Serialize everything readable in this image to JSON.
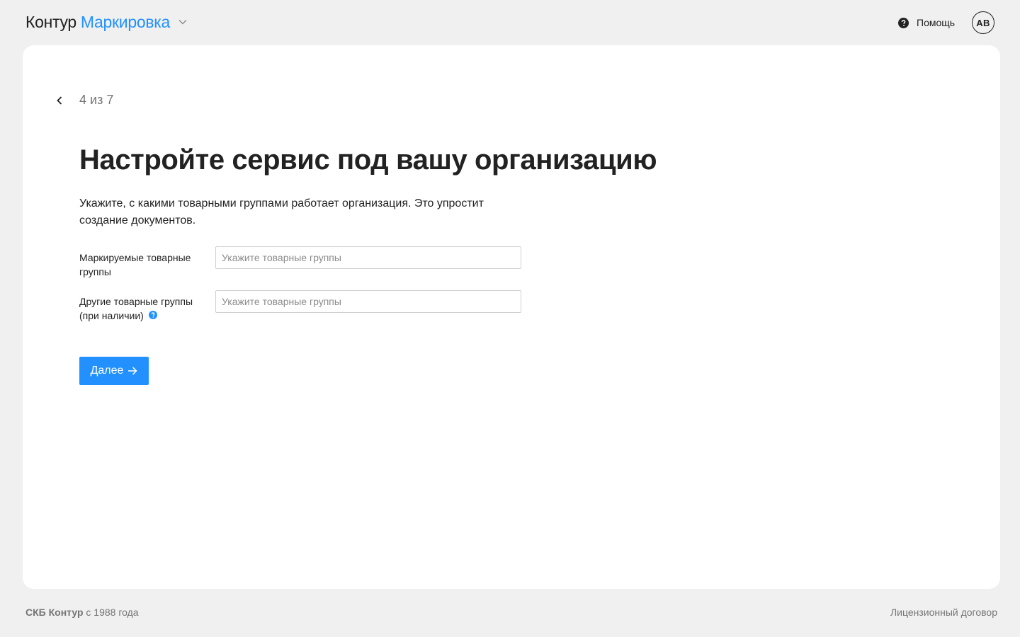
{
  "header": {
    "brand": "Контур",
    "product": "Маркировка",
    "help_label": "Помощь",
    "avatar_initials": "АВ"
  },
  "step": {
    "text": "4 из 7",
    "current": 4,
    "total": 7
  },
  "main": {
    "title": "Настройте сервис под вашу организацию",
    "description": "Укажите, с какими товарными группами работает организация. Это упростит создание документов.",
    "fields": [
      {
        "label": "Маркируемые товарные группы",
        "placeholder": "Укажите товарные группы",
        "value": ""
      },
      {
        "label": "Другие товарные группы (при наличии)",
        "placeholder": "Укажите товарные группы",
        "value": "",
        "has_info_icon": true
      }
    ],
    "next_button_label": "Далее"
  },
  "footer": {
    "company": "СКБ Контур",
    "since": "с 1988 года",
    "license_link": "Лицензионный договор"
  },
  "colors": {
    "accent": "#2291ff",
    "page_background": "#f0f0f0",
    "card_background": "#ffffff",
    "text": "#222222",
    "muted_text": "#757575"
  },
  "icons": {
    "product_menu": "chevron-down-icon",
    "help": "question-circle-icon",
    "back": "chevron-left-icon",
    "field_info": "question-circle-icon",
    "next": "arrow-right-icon"
  }
}
